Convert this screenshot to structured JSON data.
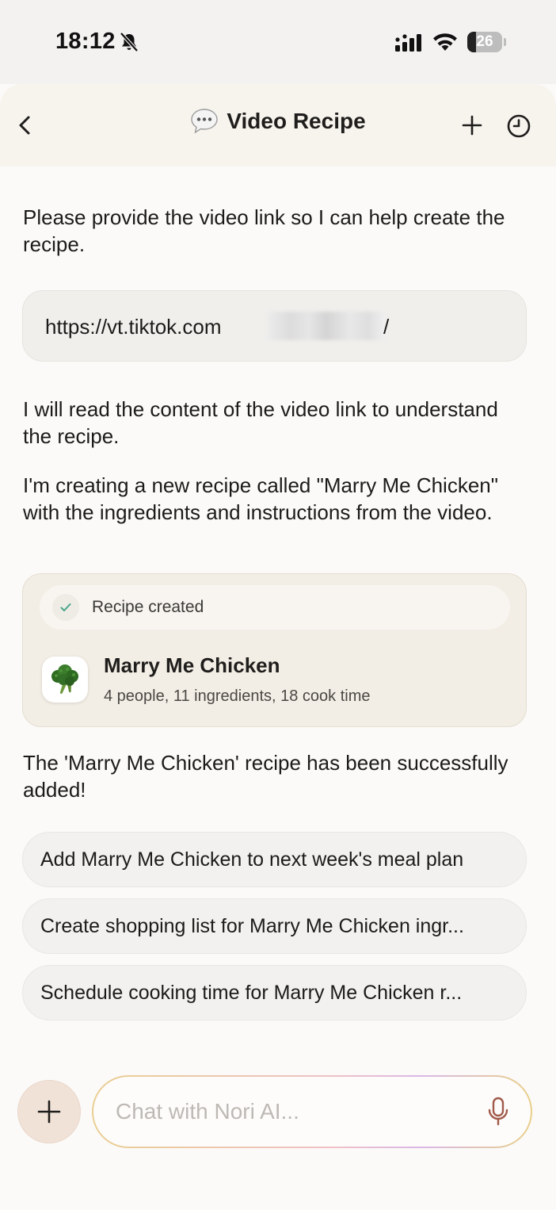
{
  "status_bar": {
    "time": "18:12",
    "battery_level": "26",
    "icons": [
      "bell-slash-icon",
      "cellular-signal-icon",
      "wifi-icon",
      "battery-icon"
    ]
  },
  "header": {
    "title": "Video Recipe",
    "title_icon": "speech-bubble-icon",
    "left_icon": "chevron-left-icon",
    "right_icons": [
      "plus-icon",
      "clock-history-icon"
    ]
  },
  "messages": {
    "assistant_1": "Please provide the video link so I can help create the recipe.",
    "user_link": "https://vt.tiktok.com",
    "user_link_suffix": "/",
    "assistant_2": "I will read the content of the video link to understand the recipe.",
    "assistant_3": "I'm creating a new recipe called \"Marry Me Chicken\" with the ingredients and instructions from the video.",
    "assistant_4": "The 'Marry Me Chicken' recipe has been successfully added!"
  },
  "recipe_card": {
    "status": "Recipe created",
    "status_icon": "check-icon",
    "thumb_icon": "broccoli-icon",
    "name": "Marry Me Chicken",
    "meta": "4 people, 11 ingredients, 18 cook time"
  },
  "suggestions": [
    "Add Marry Me Chicken to next week's meal plan",
    "Create shopping list for Marry Me Chicken ingr...",
    "Schedule cooking time for Marry Me Chicken r..."
  ],
  "composer": {
    "placeholder": "Chat with Nori AI...",
    "add_icon": "plus-icon",
    "mic_icon": "microphone-icon"
  },
  "colors": {
    "background": "#fbfaf8",
    "header_bg": "#f7f4ee",
    "card_bg": "#f3eee5",
    "check_green": "#4aa58a",
    "mic_color": "#a15a4a"
  }
}
